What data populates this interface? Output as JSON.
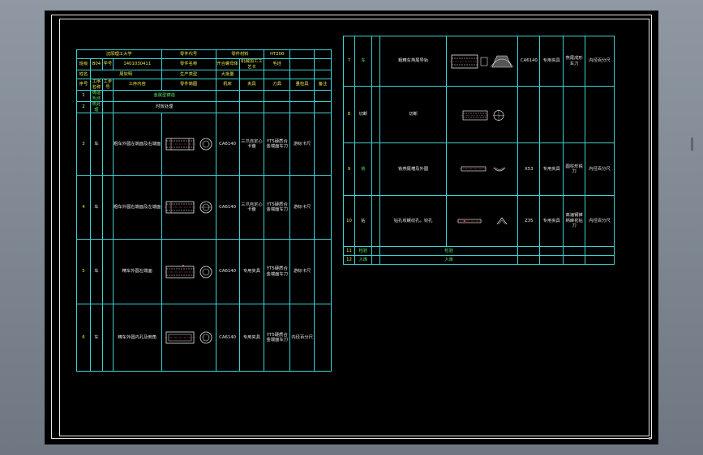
{
  "header": {
    "school": "沈阳理工大学",
    "part_code_label": "零件代号",
    "material_grade_label": "零件材料",
    "material_grade": "HT200",
    "class_label": "班级",
    "class_value": "B04",
    "student_no_label": "学号",
    "student_no": "1401030411",
    "part_name_label": "零件名称",
    "part_name": "开合螺母体",
    "process_label": "机械加工工艺卡",
    "process_tail": "毛坯",
    "name_label": "姓名",
    "name_value": "周钦明",
    "production_label": "生产类型",
    "production_value": "大批量"
  },
  "columns": {
    "seq": "序号",
    "op_name": "工序名称",
    "step_no": "工步号",
    "step_content": "工序内容",
    "sketch": "零件简图",
    "machine": "机床",
    "fixture": "夹具",
    "tool": "刀具",
    "measure": "量检具",
    "note": "备注"
  },
  "left_rows": [
    {
      "seq": "1",
      "op": "铸造毛坯",
      "content": "金属型铸造",
      "machine": "",
      "fixture": "",
      "tool": "",
      "measure": ""
    },
    {
      "seq": "2",
      "op": "热处理",
      "content": "时效处理",
      "machine": "",
      "fixture": "",
      "tool": "",
      "measure": ""
    },
    {
      "seq": "3",
      "op": "车",
      "content": "粗车外圆左端面及右端面",
      "machine": "CA6140",
      "fixture": "三爪自定心卡盘",
      "tool": "YT5硬质合金端面车刀",
      "measure": "游标卡尺"
    },
    {
      "seq": "4",
      "op": "车",
      "content": "粗车外圆右端面及左端面",
      "machine": "CA6140",
      "fixture": "三爪自定心卡盘",
      "tool": "YT5硬质合金端面车刀",
      "measure": "游标卡尺"
    },
    {
      "seq": "5",
      "op": "车",
      "content": "精车外圆左端面",
      "machine": "CA6140",
      "fixture": "专用夹具",
      "tool": "YT5硬质合金端面车刀",
      "measure": "游标卡尺"
    },
    {
      "seq": "6",
      "op": "车",
      "content": "精车外圆内孔及倒角",
      "machine": "CA6140",
      "fixture": "专用夹具",
      "tool": "YT5硬质合金端面车刀",
      "measure": "内径百分尺"
    }
  ],
  "right_rows": [
    {
      "seq": "7",
      "op": "车",
      "content": "粗精车燕尾导轨",
      "machine": "CA6140",
      "fixture": "专用夹具",
      "tool": "燕尾成形车刀",
      "measure": "内径百分尺"
    },
    {
      "seq": "8",
      "op": "切断",
      "content": "切断",
      "machine": "",
      "fixture": "",
      "tool": "",
      "measure": ""
    },
    {
      "seq": "9",
      "op": "铣",
      "content": "铣燕尾槽及外圆",
      "machine": "X53",
      "fixture": "专用夹具",
      "tool": "圆柱形铣刀",
      "measure": "内径百分尺"
    },
    {
      "seq": "10",
      "op": "钻",
      "content": "钻孔攻螺纹孔，铰孔",
      "machine": "Z35",
      "fixture": "专用夹具",
      "tool": "高速钢锥柄麻花钻刀",
      "measure": "内径百分尺"
    },
    {
      "seq": "11",
      "op": "检验",
      "content": "检验",
      "machine": "",
      "fixture": "",
      "tool": "",
      "measure": ""
    },
    {
      "seq": "12",
      "op": "入库",
      "content": "入库",
      "machine": "",
      "fixture": "",
      "tool": "",
      "measure": ""
    }
  ],
  "colors": {
    "grid": "#3fd2d2",
    "text_yellow": "#f2e84a",
    "text_green": "#58e86a",
    "background": "#000000"
  }
}
